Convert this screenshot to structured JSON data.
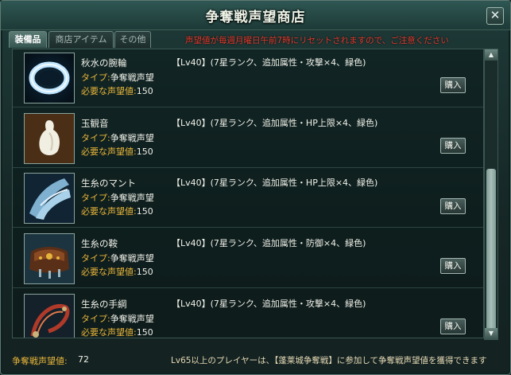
{
  "window": {
    "title": "争奪戦声望商店",
    "close_label": "✕"
  },
  "tabs": [
    {
      "label": "装備品",
      "active": true
    },
    {
      "label": "商店アイテム",
      "active": false
    },
    {
      "label": "その他",
      "active": false
    }
  ],
  "notice": "声望値が毎週月曜日午前7時にリセットされますので、ご注意ください",
  "items": [
    {
      "name": "秋水の腕輪",
      "type_label": "タイプ:",
      "type_value": "争奪戦声望",
      "cost_label": "必要な声望値:",
      "cost_value": "150",
      "desc": "【Lv40】(7星ランク、追加属性・攻撃×4、緑色)",
      "buy_label": "購入",
      "icon": "bracelet-icon"
    },
    {
      "name": "玉観音",
      "type_label": "タイプ:",
      "type_value": "争奪戦声望",
      "cost_label": "必要な声望値:",
      "cost_value": "150",
      "desc": "【Lv40】(7星ランク、追加属性・HP上限×4、緑色)",
      "buy_label": "購入",
      "icon": "jade-guanyin-icon"
    },
    {
      "name": "生糸のマント",
      "type_label": "タイプ:",
      "type_value": "争奪戦声望",
      "cost_label": "必要な声望値:",
      "cost_value": "150",
      "desc": "【Lv40】(7星ランク、追加属性・HP上限×4、緑色)",
      "buy_label": "購入",
      "icon": "cloak-icon"
    },
    {
      "name": "生糸の鞍",
      "type_label": "タイプ:",
      "type_value": "争奪戦声望",
      "cost_label": "必要な声望値:",
      "cost_value": "150",
      "desc": "【Lv40】(7星ランク、追加属性・防御×4、緑色)",
      "buy_label": "購入",
      "icon": "saddle-icon"
    },
    {
      "name": "生糸の手綱",
      "type_label": "タイプ:",
      "type_value": "争奪戦声望",
      "cost_label": "必要な声望値:",
      "cost_value": "150",
      "desc": "【Lv40】(7星ランク、追加属性・攻撃×4、緑色)",
      "buy_label": "購入",
      "icon": "reins-icon"
    }
  ],
  "footer": {
    "reputation_label": "争奪戦声望値:",
    "reputation_value": "72",
    "info": "Lv65以上のプレイヤーは、【蓬莱城争奪戦】に参加して争奪戦声望値を獲得できます"
  },
  "scroll": {
    "up": "▲",
    "down": "▼"
  }
}
